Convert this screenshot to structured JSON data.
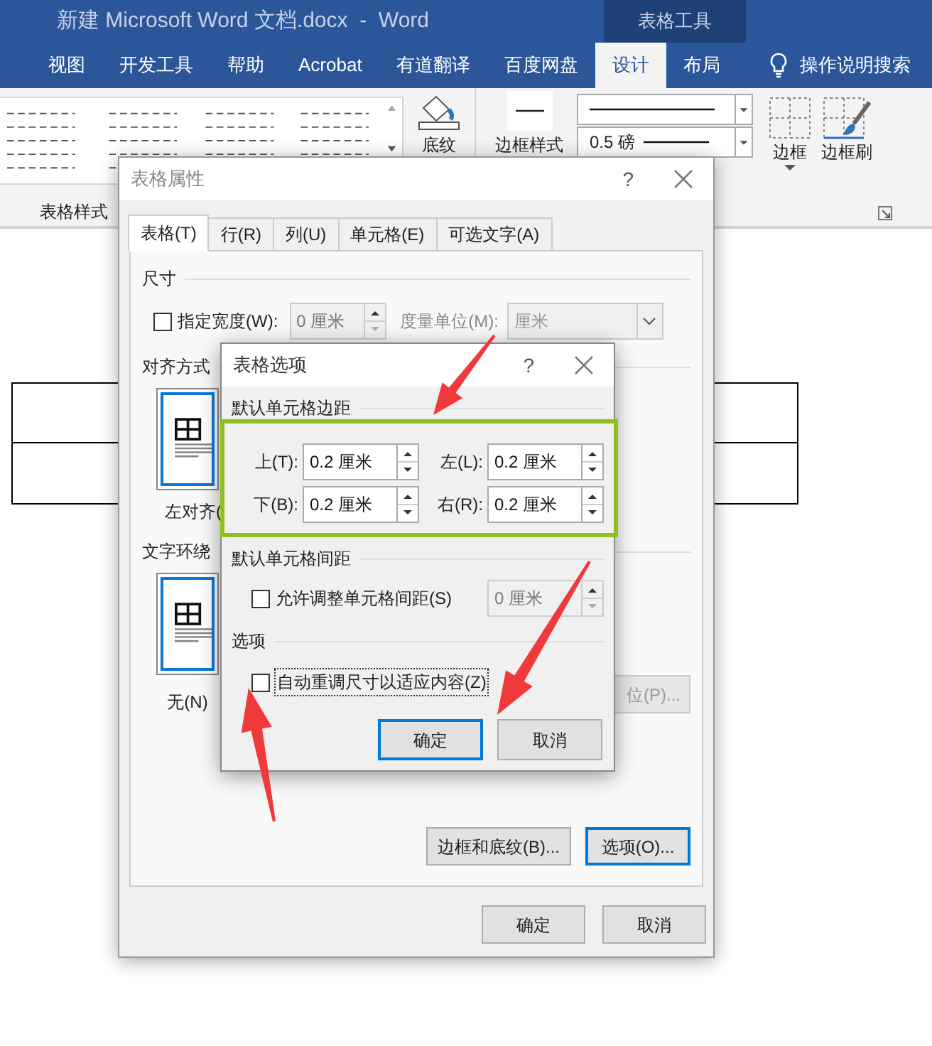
{
  "title_bar": {
    "title": "新建 Microsoft Word 文档.docx  -  Word",
    "context_group": "表格工具"
  },
  "ribbon_tabs": [
    {
      "label": "视图",
      "selected": false
    },
    {
      "label": "开发工具",
      "selected": false
    },
    {
      "label": "帮助",
      "selected": false
    },
    {
      "label": "Acrobat",
      "selected": false
    },
    {
      "label": "有道翻译",
      "selected": false
    },
    {
      "label": "百度网盘",
      "selected": false
    },
    {
      "label": "设计",
      "selected": true
    },
    {
      "label": "布局",
      "selected": false
    }
  ],
  "tell_me": "操作说明搜索",
  "ribbon": {
    "shading": "底纹",
    "table_styles": "表格样式",
    "border_styles": "边框样式",
    "line_weight": "0.5 磅",
    "borders": "边框",
    "border_painter": "边框刷"
  },
  "table_properties": {
    "title": "表格属性",
    "help": "?",
    "tabs": [
      {
        "label": "表格(T)",
        "selected": true
      },
      {
        "label": "行(R)",
        "selected": false
      },
      {
        "label": "列(U)",
        "selected": false
      },
      {
        "label": "单元格(E)",
        "selected": false
      },
      {
        "label": "可选文字(A)",
        "selected": false
      }
    ],
    "size_section": "尺寸",
    "preferred_width": {
      "label": "指定宽度(W):",
      "checked": false,
      "value": "0 厘米"
    },
    "measure_in": {
      "label": "度量单位(M):",
      "value": "厘米"
    },
    "alignment_section": "对齐方式",
    "alignment": {
      "label": "左对齐(",
      "selected": true
    },
    "wrapping_section": "文字环绕",
    "wrapping": {
      "label": "无(N)",
      "selected": true
    },
    "positioning": "位(P)...",
    "borders_button": "边框和底纹(B)...",
    "options_button": "选项(O)...",
    "ok": "确定",
    "cancel": "取消"
  },
  "table_options": {
    "title": "表格选项",
    "help": "?",
    "margins_section": "默认单元格边距",
    "margins": [
      {
        "label": "上(T):",
        "value": "0.2 厘米"
      },
      {
        "label": "左(L):",
        "value": "0.2 厘米"
      },
      {
        "label": "下(B):",
        "value": "0.2 厘米"
      },
      {
        "label": "右(R):",
        "value": "0.2 厘米"
      }
    ],
    "spacing_section": "默认单元格间距",
    "allow_spacing": {
      "label": "允许调整单元格间距(S)",
      "checked": false,
      "value": "0 厘米"
    },
    "options_section": "选项",
    "auto_resize": {
      "label": "自动重调尺寸以适应内容(Z)",
      "checked": false
    },
    "ok": "确定",
    "cancel": "取消"
  }
}
